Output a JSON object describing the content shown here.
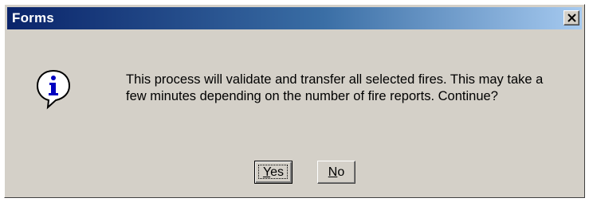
{
  "window": {
    "title": "Forms",
    "close_glyph": "×"
  },
  "message": {
    "text": "This process will validate and transfer all selected fires.  This may take a few minutes depending on the number of fire reports.  Continue?",
    "icon": "info-icon"
  },
  "buttons": {
    "yes": {
      "mnemonic": "Y",
      "rest": "es"
    },
    "no": {
      "mnemonic": "N",
      "rest": "o"
    }
  },
  "colors": {
    "title_start": "#0a246a",
    "title_end": "#a6caf0",
    "face": "#d4d0c8",
    "icon_blue": "#0000c0"
  }
}
